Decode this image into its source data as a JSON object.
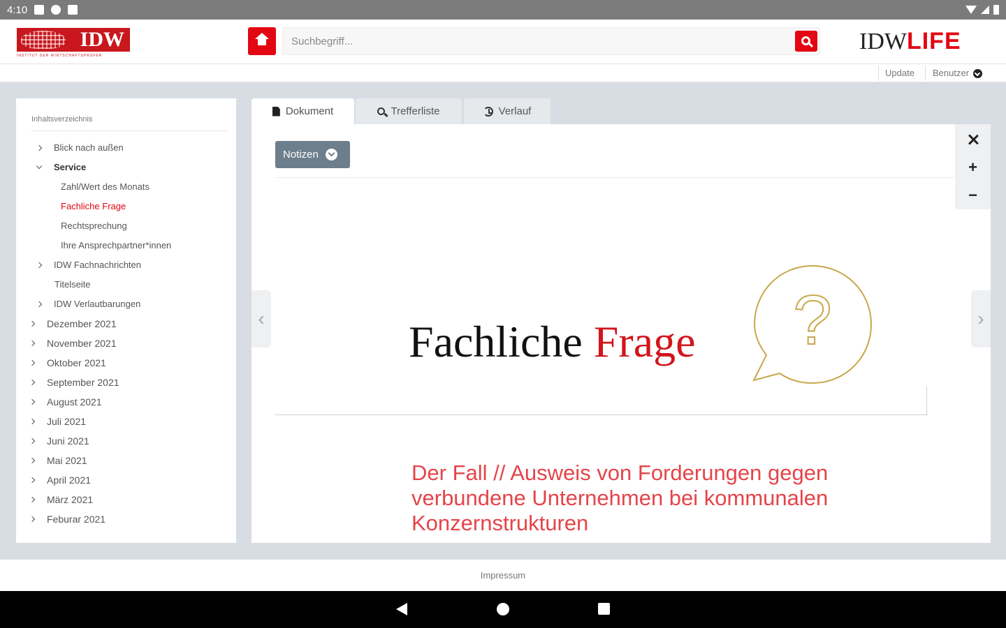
{
  "status_bar": {
    "time": "4:10"
  },
  "header": {
    "logo_text": "IDW",
    "logo_subtitle": "INSTITUT DER WIRTSCHAFTSPRÜFER",
    "search_placeholder": "Suchbegriff...",
    "brand_left": "IDW",
    "brand_right": "LIFE"
  },
  "subbar": {
    "update_label": "Update",
    "user_label": "Benutzer"
  },
  "sidebar": {
    "title": "Inhaltsverzeichnis",
    "items": [
      {
        "label": "Blick nach außen",
        "expandable": true
      },
      {
        "label": "Service",
        "expandable": true,
        "expanded": true
      },
      {
        "label": "Zahl/Wert des Monats"
      },
      {
        "label": "Fachliche Frage",
        "active": true
      },
      {
        "label": "Rechtsprechung"
      },
      {
        "label": "Ihre Ansprechpartner*innen"
      },
      {
        "label": "IDW Fachnachrichten",
        "expandable": true
      },
      {
        "label": "Titelseite"
      },
      {
        "label": "IDW Verlautbarungen",
        "expandable": true
      },
      {
        "label": "Dezember 2021",
        "expandable": true
      },
      {
        "label": "November 2021",
        "expandable": true
      },
      {
        "label": "Oktober 2021",
        "expandable": true
      },
      {
        "label": "September 2021",
        "expandable": true
      },
      {
        "label": "August 2021",
        "expandable": true
      },
      {
        "label": "Juli 2021",
        "expandable": true
      },
      {
        "label": "Juni 2021",
        "expandable": true
      },
      {
        "label": "Mai 2021",
        "expandable": true
      },
      {
        "label": "April 2021",
        "expandable": true
      },
      {
        "label": "März 2021",
        "expandable": true
      },
      {
        "label": "Feburar 2021",
        "expandable": true
      }
    ]
  },
  "tabs": [
    {
      "label": "Dokument",
      "icon": "document-icon",
      "active": true
    },
    {
      "label": "Trefferliste",
      "icon": "search-icon"
    },
    {
      "label": "Verlauf",
      "icon": "history-icon"
    }
  ],
  "document": {
    "notes_label": "Notizen",
    "hero_title_black": "Fachliche",
    "hero_title_red": "Frage",
    "bubble_symbol": "?",
    "case_heading": "Der Fall // Ausweis von Forderungen gegen verbundene Unternehmen bei kommunalen Konzernstrukturen",
    "prev_arrow": "‹",
    "next_arrow": "›",
    "zoom_in": "+",
    "zoom_out": "−"
  },
  "footer": {
    "impressum": "Impressum"
  },
  "colors": {
    "brand_red": "#e30613",
    "title_red": "#d2151c",
    "accent_gold": "#c8a84a",
    "notes_gray": "#6d7e8c"
  }
}
